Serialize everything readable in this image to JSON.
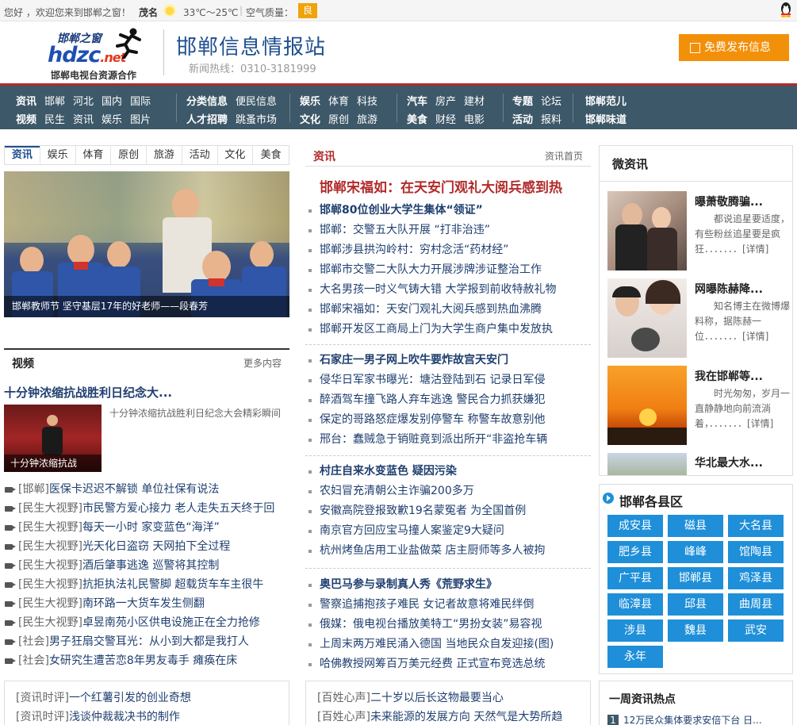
{
  "topbar": {
    "greeting": "您好 ，欢迎您来到邯郸之窗！",
    "city": "茂名",
    "temperature": "33℃～25℃",
    "air_label": "空气质量：",
    "air_value": "良"
  },
  "header": {
    "logo_cn": "邯郸之窗",
    "logo_en": "hdzc",
    "logo_en_suffix": ".net",
    "logo_sub": "邯郸电视台资源合作",
    "site_title": "邯郸信息情报站",
    "hotline": "新闻热线：0310-3181999",
    "publish_button": "免费发布信息"
  },
  "nav": [
    {
      "row1": [
        "资讯",
        "邯郸",
        "河北",
        "国内",
        "国际"
      ],
      "row2": [
        "视频",
        "民生",
        "资讯",
        "娱乐",
        "图片"
      ]
    },
    {
      "row1": [
        "分类信息",
        "便民信息"
      ],
      "row2": [
        "人才招聘",
        "跳蚤市场"
      ]
    },
    {
      "row1": [
        "娱乐",
        "体育",
        "科技"
      ],
      "row2": [
        "文化",
        "原创",
        "旅游"
      ]
    },
    {
      "row1": [
        "汽车",
        "房产",
        "建材"
      ],
      "row2": [
        "美食",
        "财经",
        "电影"
      ]
    },
    {
      "row1": [
        "专题",
        "论坛"
      ],
      "row2": [
        "活动",
        "报料"
      ]
    },
    {
      "row1": [
        "邯郸范儿"
      ],
      "row2": [
        "邯郸味道"
      ]
    }
  ],
  "left": {
    "tabs": [
      "资讯",
      "娱乐",
      "体育",
      "原创",
      "旅游",
      "活动",
      "文化",
      "美食"
    ],
    "feature_caption": "邯郸教师节 坚守基层17年的好老师——段春芳",
    "video_section": {
      "title": "视频",
      "more": "更多内容"
    },
    "video_title": "十分钟浓缩抗战胜利日纪念大...",
    "video_thumb_caption": "十分钟浓缩抗战",
    "video_desc": "十分钟浓缩抗战胜利日纪念大会精彩瞬间",
    "video_list": [
      {
        "tag": "[邯郸]",
        "text": "医保卡迟迟不解锁 单位社保有说法"
      },
      {
        "tag": "[民生大视野]",
        "text": "市民警方爱心接力 老人走失五天终于回"
      },
      {
        "tag": "[民生大视野]",
        "text": "每天一小时 家变蓝色“海洋”"
      },
      {
        "tag": "[民生大视野]",
        "text": "光天化日盗窃 天网拍下全过程"
      },
      {
        "tag": "[民生大视野]",
        "text": "酒后肇事逃逸 巡警将其控制"
      },
      {
        "tag": "[民生大视野]",
        "text": "抗拒执法礼民警脚 超载货车车主很牛"
      },
      {
        "tag": "[民生大视野]",
        "text": "南环路一大货车发生侧翻"
      },
      {
        "tag": "[民生大视野]",
        "text": "卓昱南苑小区供电设施正在全力抢修"
      },
      {
        "tag": "[社会]",
        "text": "男子狂扇交警耳光：从小到大都是我打人"
      },
      {
        "tag": "[社会]",
        "text": "女研究生遭苦恋8年男友毒手 瘫痪在床"
      }
    ],
    "bottom_list": [
      {
        "tag": "[资讯时评]",
        "text": "一个红薯引发的创业奇想"
      },
      {
        "tag": "[资讯时评]",
        "text": "浅谈仲裁裁决书的制作"
      }
    ]
  },
  "middle": {
    "section": {
      "title": "资讯",
      "more": "资讯首页"
    },
    "headline": "邯郸宋福如：在天安门观礼大阅兵感到热",
    "groups": [
      {
        "items": [
          "邯郸80位创业大学生集体“领证”",
          "邯郸：交警五大队开展 “打非治违”",
          "邯郸涉县拱沟岭村：穷村念活“药材经”",
          "邯郸市交警二大队大力开展涉牌涉证整治工作",
          "大名男孩一时义气铸大错 大学报到前收特赦礼物",
          "邯郸宋福如：天安门观礼大阅兵感到热血沸腾",
          "邯郸开发区工商局上门为大学生商户集中发放执"
        ]
      },
      {
        "items": [
          "石家庄一男子网上吹牛要炸故宫天安门",
          "侵华日军家书曝光：塘沽登陆到石 记录日军侵",
          "醉酒驾车撞飞路人弃车逃逸 警民合力抓获嫌犯",
          "保定的哥路怒症爆发别停警车 称警车故意别他",
          "邢台：蠢贼急于销赃竟到派出所开“非盗抢车辆"
        ]
      },
      {
        "items": [
          "村庄自来水变蓝色 疑因污染",
          "农妇冒充清朝公主诈骗200多万",
          "安徽高院登报致歉19名蒙冤者 为全国首例",
          "南京官方回应宝马撞人案鉴定9大疑问",
          "杭州烤鱼店用工业盐做菜 店主厨师等多人被拘"
        ]
      },
      {
        "items": [
          "奥巴马参与录制真人秀《荒野求生》",
          "警察追捕抱孩子难民 女记者故意将难民绊倒",
          "俄媒：俄电视台播放美特工“男扮女装”易容视",
          "上周末两万难民涌入德国 当地民众自发迎接(图)",
          "哈佛教授网筹百万美元经费 正式宣布竞选总统"
        ]
      }
    ],
    "bottom_list": [
      {
        "tag": "[百姓心声]",
        "text": "二十岁以后长这物最要当心"
      },
      {
        "tag": "[百姓心声]",
        "text": "未来能源的发展方向 天然气是大势所趋"
      }
    ]
  },
  "right": {
    "weizixun": {
      "title": "微资讯"
    },
    "weixin_items": [
      {
        "title": "曝萧敬腾骗...",
        "desc": "都说追星要适度，有些粉丝追星要是疯狂．．．．．．．[详情]"
      },
      {
        "title": "网曝陈赫降...",
        "desc": "知名博主在微博爆料称，据陈赫一位．．．．．．．[详情]"
      },
      {
        "title": "我在邯郸等...",
        "desc": "时光匆匆，岁月一直静静地向前流淌着，．．．．．．．[详情]"
      },
      {
        "title": "华北最大水...",
        "desc": ""
      }
    ],
    "counties": {
      "title": "邯郸各县区",
      "items": [
        "成安县",
        "磁县",
        "大名县",
        "肥乡县",
        "峰峰",
        "馆陶县",
        "广平县",
        "邯郸县",
        "鸡泽县",
        "临漳县",
        "邱县",
        "曲周县",
        "涉县",
        "魏县",
        "武安",
        "永年"
      ]
    },
    "weekly": {
      "title": "一周资讯热点",
      "first_rank": "1",
      "first_item": "12万民众集体要求安倍下台 日..."
    }
  }
}
